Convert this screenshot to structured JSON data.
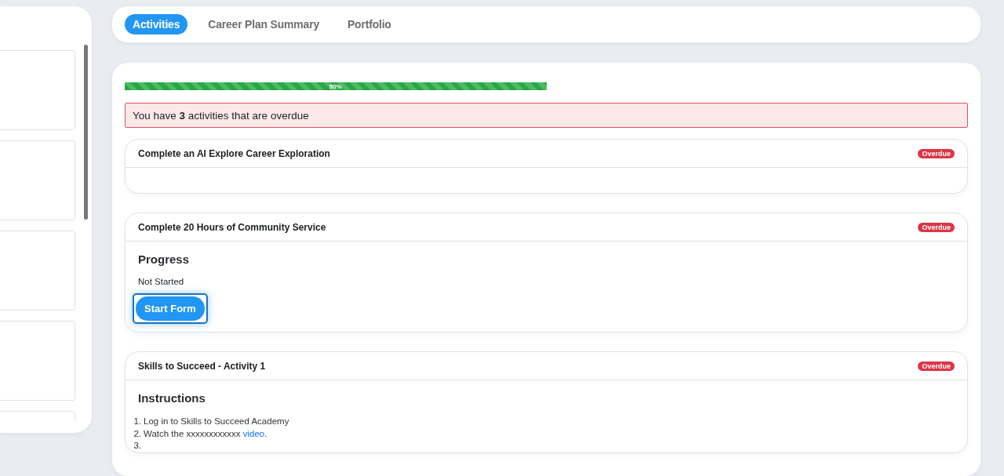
{
  "tabs": [
    {
      "label": "Activities",
      "selected": true
    },
    {
      "label": "Career Plan Summary",
      "selected": false
    },
    {
      "label": "Portfolio",
      "selected": false
    }
  ],
  "progress": {
    "level": 0.5,
    "label": "50%"
  },
  "alert": "You have **3** activities that are overdue",
  "activities": [
    {
      "kind": "empty",
      "title": "Complete an AI Explore Career Exploration",
      "badge": "Overdue"
    },
    {
      "kind": "progress",
      "title": "Complete 20 Hours of Community Service",
      "badge": "Overdue",
      "section_title": "Progress",
      "status": "Not Started",
      "button": "Start Form",
      "button_focused": true
    },
    {
      "kind": "instructions",
      "title": "Skills to Succeed - Activity 1",
      "badge": "Overdue",
      "section_title": "Instructions",
      "steps": [
        {
          "number": "1.",
          "text": "Log in to Skills to Succeed Academy"
        },
        {
          "number": "2.",
          "text": "Watch the xxxxxxxxxxxx ",
          "link": "video",
          "after": "."
        },
        {
          "number": "3."
        }
      ]
    }
  ]
}
